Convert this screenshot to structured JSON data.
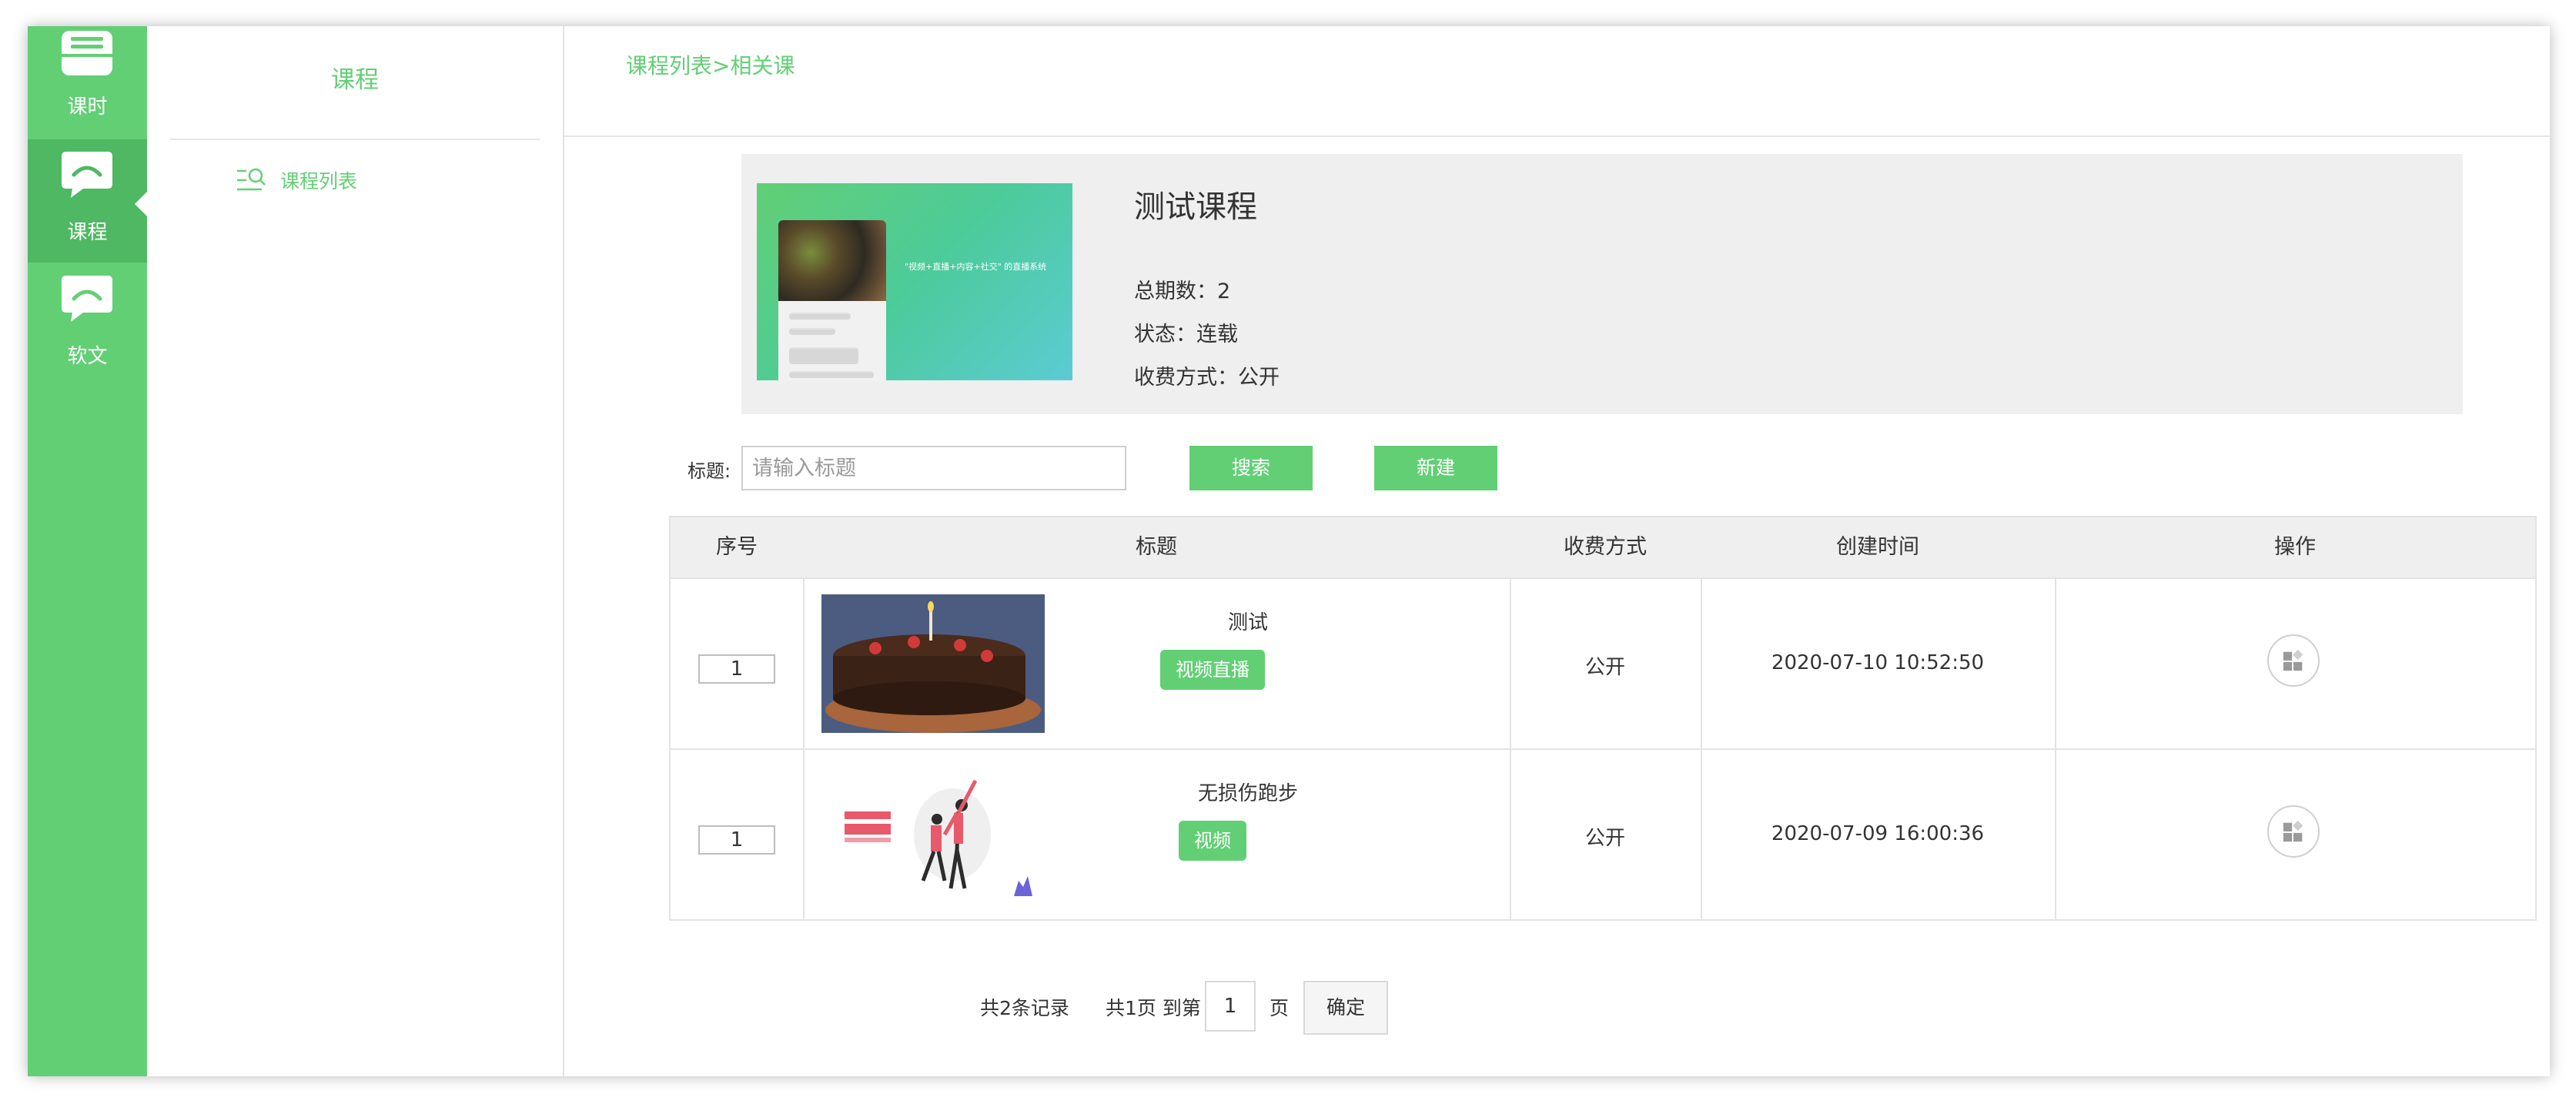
{
  "rail": {
    "items": [
      {
        "label": "课时",
        "icon": "drawer-icon"
      },
      {
        "label": "课程",
        "icon": "chat-bubble-icon",
        "active": true
      },
      {
        "label": "软文",
        "icon": "chat-bubble-icon"
      }
    ]
  },
  "subnav": {
    "title": "课程",
    "items": [
      {
        "label": "课程列表",
        "icon": "list-search-icon"
      }
    ]
  },
  "breadcrumb": "课程列表>相关课",
  "course": {
    "title": "测试课程",
    "total_label": "总期数：",
    "total_value": "2",
    "status_label": "状态：",
    "status_value": "连载",
    "fee_label": "收费方式：",
    "fee_value": "公开",
    "cover_slogan": "\"视频+直播+内容+社交\" 的直播系统"
  },
  "filter": {
    "label": "标题:",
    "placeholder": "请输入标题",
    "search_label": "搜索",
    "new_label": "新建"
  },
  "table": {
    "headers": [
      "序号",
      "标题",
      "收费方式",
      "创建时间",
      "操作"
    ],
    "rows": [
      {
        "index": "1",
        "title": "测试",
        "tag": "视频直播",
        "fee": "公开",
        "created": "2020-07-10 10:52:50",
        "thumb": "cake-photo"
      },
      {
        "index": "1",
        "title": "无损伤跑步",
        "tag": "视频",
        "fee": "公开",
        "created": "2020-07-09 16:00:36",
        "thumb": "running-illustration"
      }
    ]
  },
  "pagination": {
    "total_records": "共2条记录",
    "total_pages": "共1页 到第",
    "page_value": "1",
    "page_unit": "页",
    "confirm_label": "确定"
  },
  "colors": {
    "accent": "#62cf75",
    "accent_dark": "#4fb862",
    "header_bg": "#efefef"
  }
}
